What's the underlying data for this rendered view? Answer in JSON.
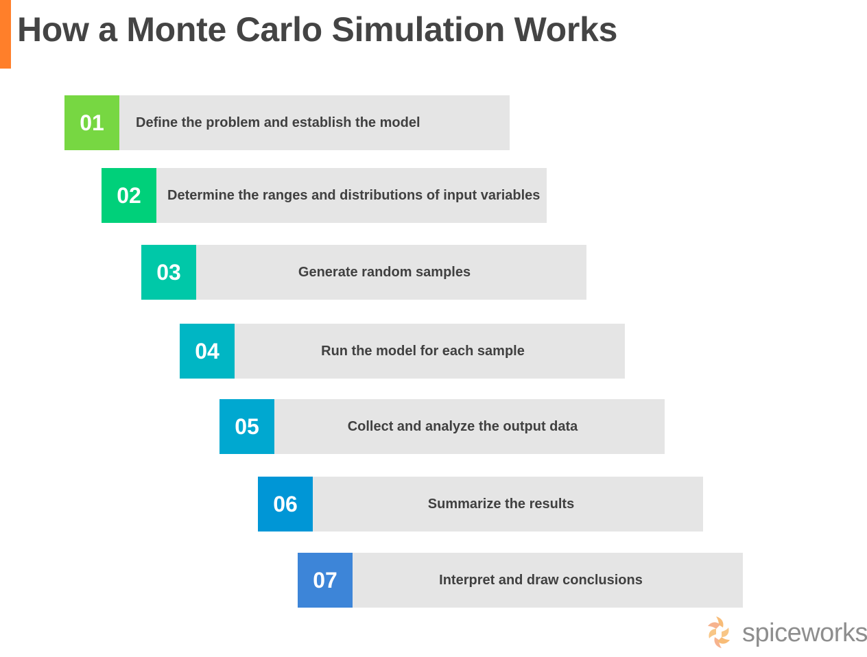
{
  "header": {
    "title": "How a Monte Carlo Simulation Works",
    "accent_color": "#ff7f2a"
  },
  "steps": [
    {
      "number": "01",
      "label": "Define the problem and establish the model",
      "color": "#77d742"
    },
    {
      "number": "02",
      "label": "Determine the ranges and distributions of input variables",
      "color": "#00d07a"
    },
    {
      "number": "03",
      "label": "Generate random samples",
      "color": "#00c8a8"
    },
    {
      "number": "04",
      "label": "Run the model for each sample",
      "color": "#00b6c4"
    },
    {
      "number": "05",
      "label": "Collect and analyze the output data",
      "color": "#00a8d0"
    },
    {
      "number": "06",
      "label": "Summarize the results",
      "color": "#0096d6"
    },
    {
      "number": "07",
      "label": "Interpret and draw conclusions",
      "color": "#3d85d8"
    }
  ],
  "branding": {
    "logo_text": "spiceworks",
    "icon": "spiceworks-swirl-icon"
  }
}
